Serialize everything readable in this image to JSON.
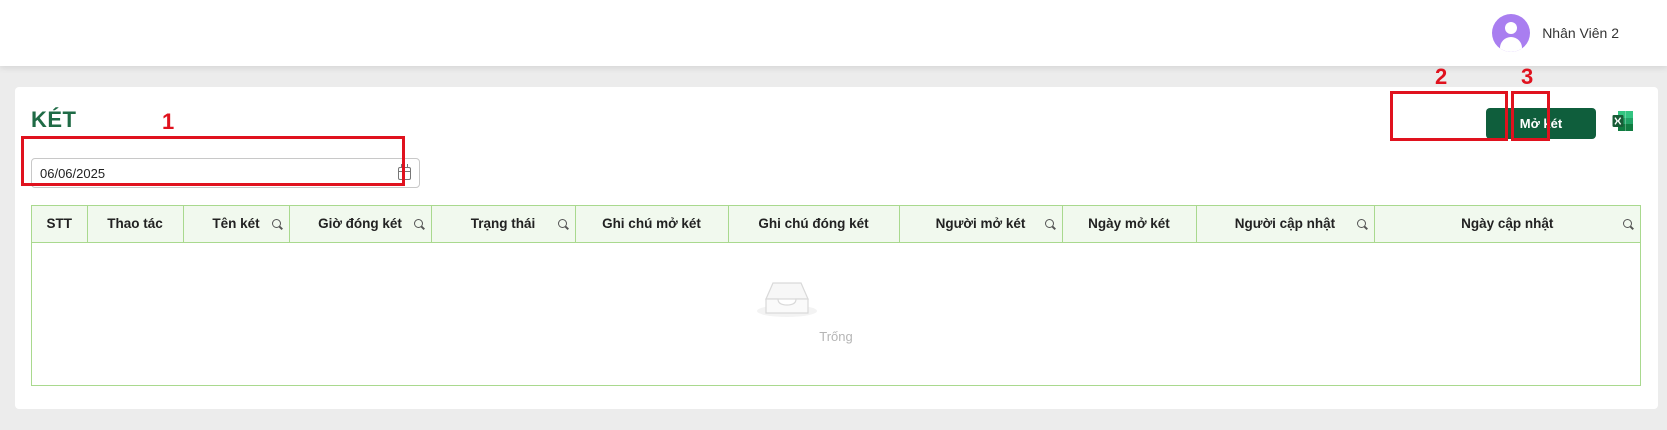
{
  "header": {
    "user_name": "Nhân Viên 2"
  },
  "page": {
    "title": "KÉT"
  },
  "filter": {
    "date_value": "06/06/2025"
  },
  "toolbar": {
    "open_label": "Mở két"
  },
  "table": {
    "columns": [
      {
        "label": "STT",
        "searchable": false
      },
      {
        "label": "Thao tác",
        "searchable": false
      },
      {
        "label": "Tên két",
        "searchable": true
      },
      {
        "label": "Giờ đóng két",
        "searchable": true
      },
      {
        "label": "Trạng thái",
        "searchable": true
      },
      {
        "label": "Ghi chú mở két",
        "searchable": false
      },
      {
        "label": "Ghi chú đóng két",
        "searchable": false
      },
      {
        "label": "Người mở két",
        "searchable": true
      },
      {
        "label": "Ngày mở két",
        "searchable": false
      },
      {
        "label": "Người cập nhật",
        "searchable": true
      },
      {
        "label": "Ngày cập nhật",
        "searchable": true
      }
    ],
    "empty_text": "Trống"
  },
  "annotations": {
    "marker_1": "1",
    "marker_2": "2",
    "marker_3": "3",
    "color": "#e0121e"
  },
  "colors": {
    "primary": "#0f5e3c",
    "title": "#1f6b46",
    "table_border": "#a9d98e",
    "header_bg": "#f1f9ee",
    "avatar": "#a97ef0",
    "excel": "#1d7a43"
  },
  "icons": {
    "avatar": "user-avatar-icon",
    "date": "calendar-icon",
    "column_filter": "search-icon",
    "export": "excel-icon",
    "empty": "empty-inbox-icon"
  }
}
